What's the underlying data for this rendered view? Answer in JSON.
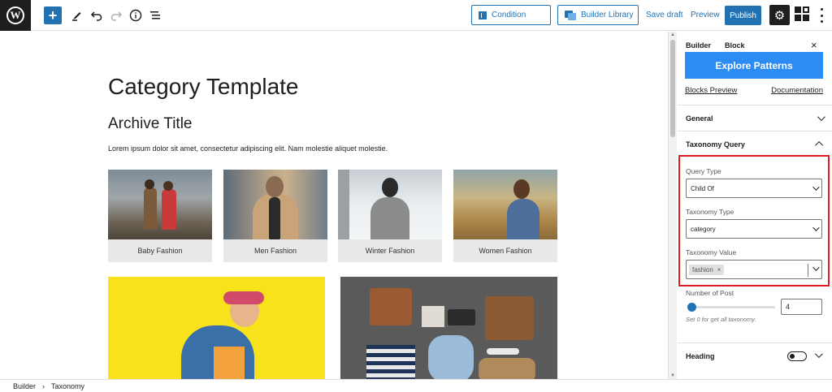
{
  "toolbar": {
    "wp_logo": "W",
    "add_label": "+",
    "condition_label": "Condition",
    "builder_library_label": "Builder Library",
    "save_draft_label": "Save draft",
    "preview_label": "Preview",
    "publish_label": "Publish",
    "settings_icon": "⚙"
  },
  "canvas": {
    "page_title": "Category Template",
    "archive_title": "Archive Title",
    "description": "Lorem ipsum dolor sit amet, consectetur adipiscing elit. Nam molestie aliquet molestie.",
    "categories": [
      {
        "label": "Baby Fashion"
      },
      {
        "label": "Men Fashion"
      },
      {
        "label": "Winter Fashion"
      },
      {
        "label": "Women Fashion"
      }
    ]
  },
  "sidebar": {
    "tabs": [
      "Builder",
      "Block"
    ],
    "close_icon": "×",
    "explore_label": "Explore Patterns",
    "blocks_preview_label": "Blocks Preview",
    "documentation_label": "Documentation",
    "general_label": "General",
    "taxonomy_query_label": "Taxonomy Query",
    "query_type_label": "Query Type",
    "query_type_value": "Child Of",
    "taxonomy_type_label": "Taxonomy Type",
    "taxonomy_type_value": "category",
    "taxonomy_value_label": "Taxonomy Value",
    "taxonomy_value_tag": "fashion",
    "tag_remove": "×",
    "number_of_post_label": "Number of Post",
    "number_of_post_value": "4",
    "number_of_post_slider": 0.03,
    "hint": "Set 0 for get all taxonomy.",
    "heading_label": "Heading",
    "heading_toggle": "off"
  },
  "footer": {
    "crumbs": [
      "Builder",
      "Taxonomy"
    ],
    "separator": "›"
  },
  "colors": {
    "accent": "#2271b1",
    "explore": "#2b8cf4",
    "highlight": "#e01b24",
    "dark": "#1e1e1e"
  }
}
